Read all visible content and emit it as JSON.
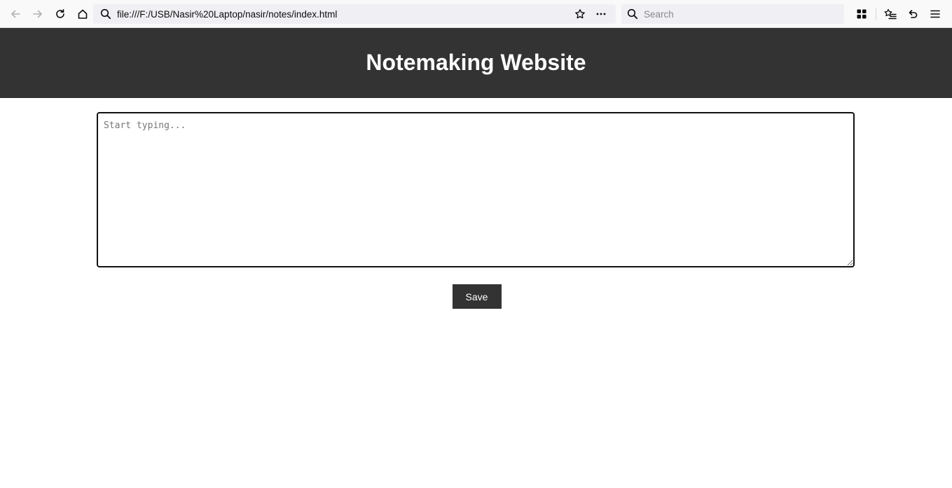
{
  "browser": {
    "url": "file:///F:/USB/Nasir%20Laptop/nasir/notes/index.html",
    "search_placeholder": "Search"
  },
  "page": {
    "title": "Notemaking Website",
    "editor_placeholder": "Start typing...",
    "save_label": "Save"
  },
  "colors": {
    "header_bg": "#333333",
    "button_bg": "#333333",
    "accent_text": "#ffffff"
  }
}
